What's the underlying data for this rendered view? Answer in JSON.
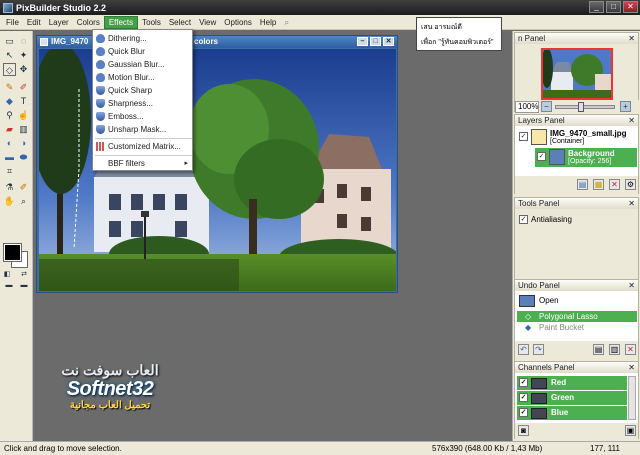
{
  "window": {
    "title": "PixBuilder Studio 2.2",
    "buttons": {
      "minimize": "_",
      "maximize": "□",
      "close": "✕"
    }
  },
  "menu": [
    "File",
    "Edit",
    "Layer",
    "Colors",
    "Effects",
    "Tools",
    "Select",
    "View",
    "Options",
    "Help"
  ],
  "effects_menu": {
    "items": [
      "Dithering...",
      "Quick Blur",
      "Gaussian Blur...",
      "Motion Blur...",
      "Quick Sharp",
      "Sharpness...",
      "Emboss...",
      "Unsharp Mask...",
      "Customized Matrix...",
      "BBF filters"
    ]
  },
  "document": {
    "title": "IMG_9470",
    "title_overflow": "colors",
    "buttons": {
      "minimize": "–",
      "maximize": "□",
      "close": "✕"
    }
  },
  "tooltip": {
    "line1": "เสน อารมณ์ดี",
    "line2": "เพื่อก \"รู้ทันคอมพิวเตอร์\""
  },
  "navigator": {
    "title": "n Panel",
    "zoom": "100%"
  },
  "layers": {
    "title": "Layers Panel",
    "rows": [
      {
        "name": "IMG_9470_small.jpg",
        "sub": "[Container]"
      },
      {
        "name": "Background",
        "sub": "[Opacity: 256]"
      }
    ]
  },
  "tools_panel": {
    "title": "Tools Panel",
    "antialiasing": "Antialiasing"
  },
  "undo": {
    "title": "Undo Panel",
    "rows": [
      "Open",
      "Polygonal Lasso",
      "Paint Bucket"
    ]
  },
  "channels": {
    "title": "Channels Panel",
    "rows": [
      "Red",
      "Green",
      "Blue"
    ]
  },
  "status": {
    "hint": "Click and drag to move selection.",
    "dimensions": "576x390 (648.00 Kb / 1,43 Mb)",
    "coords": "177, 111"
  },
  "watermark": {
    "arabic_top": "العاب سوفت نت",
    "brand": "Softnet32",
    "arabic_bottom": "تحميل العاب مجانية"
  },
  "colors": {
    "accent_green": "#4caf50",
    "doc_title_blue": "#2e5e9e"
  }
}
